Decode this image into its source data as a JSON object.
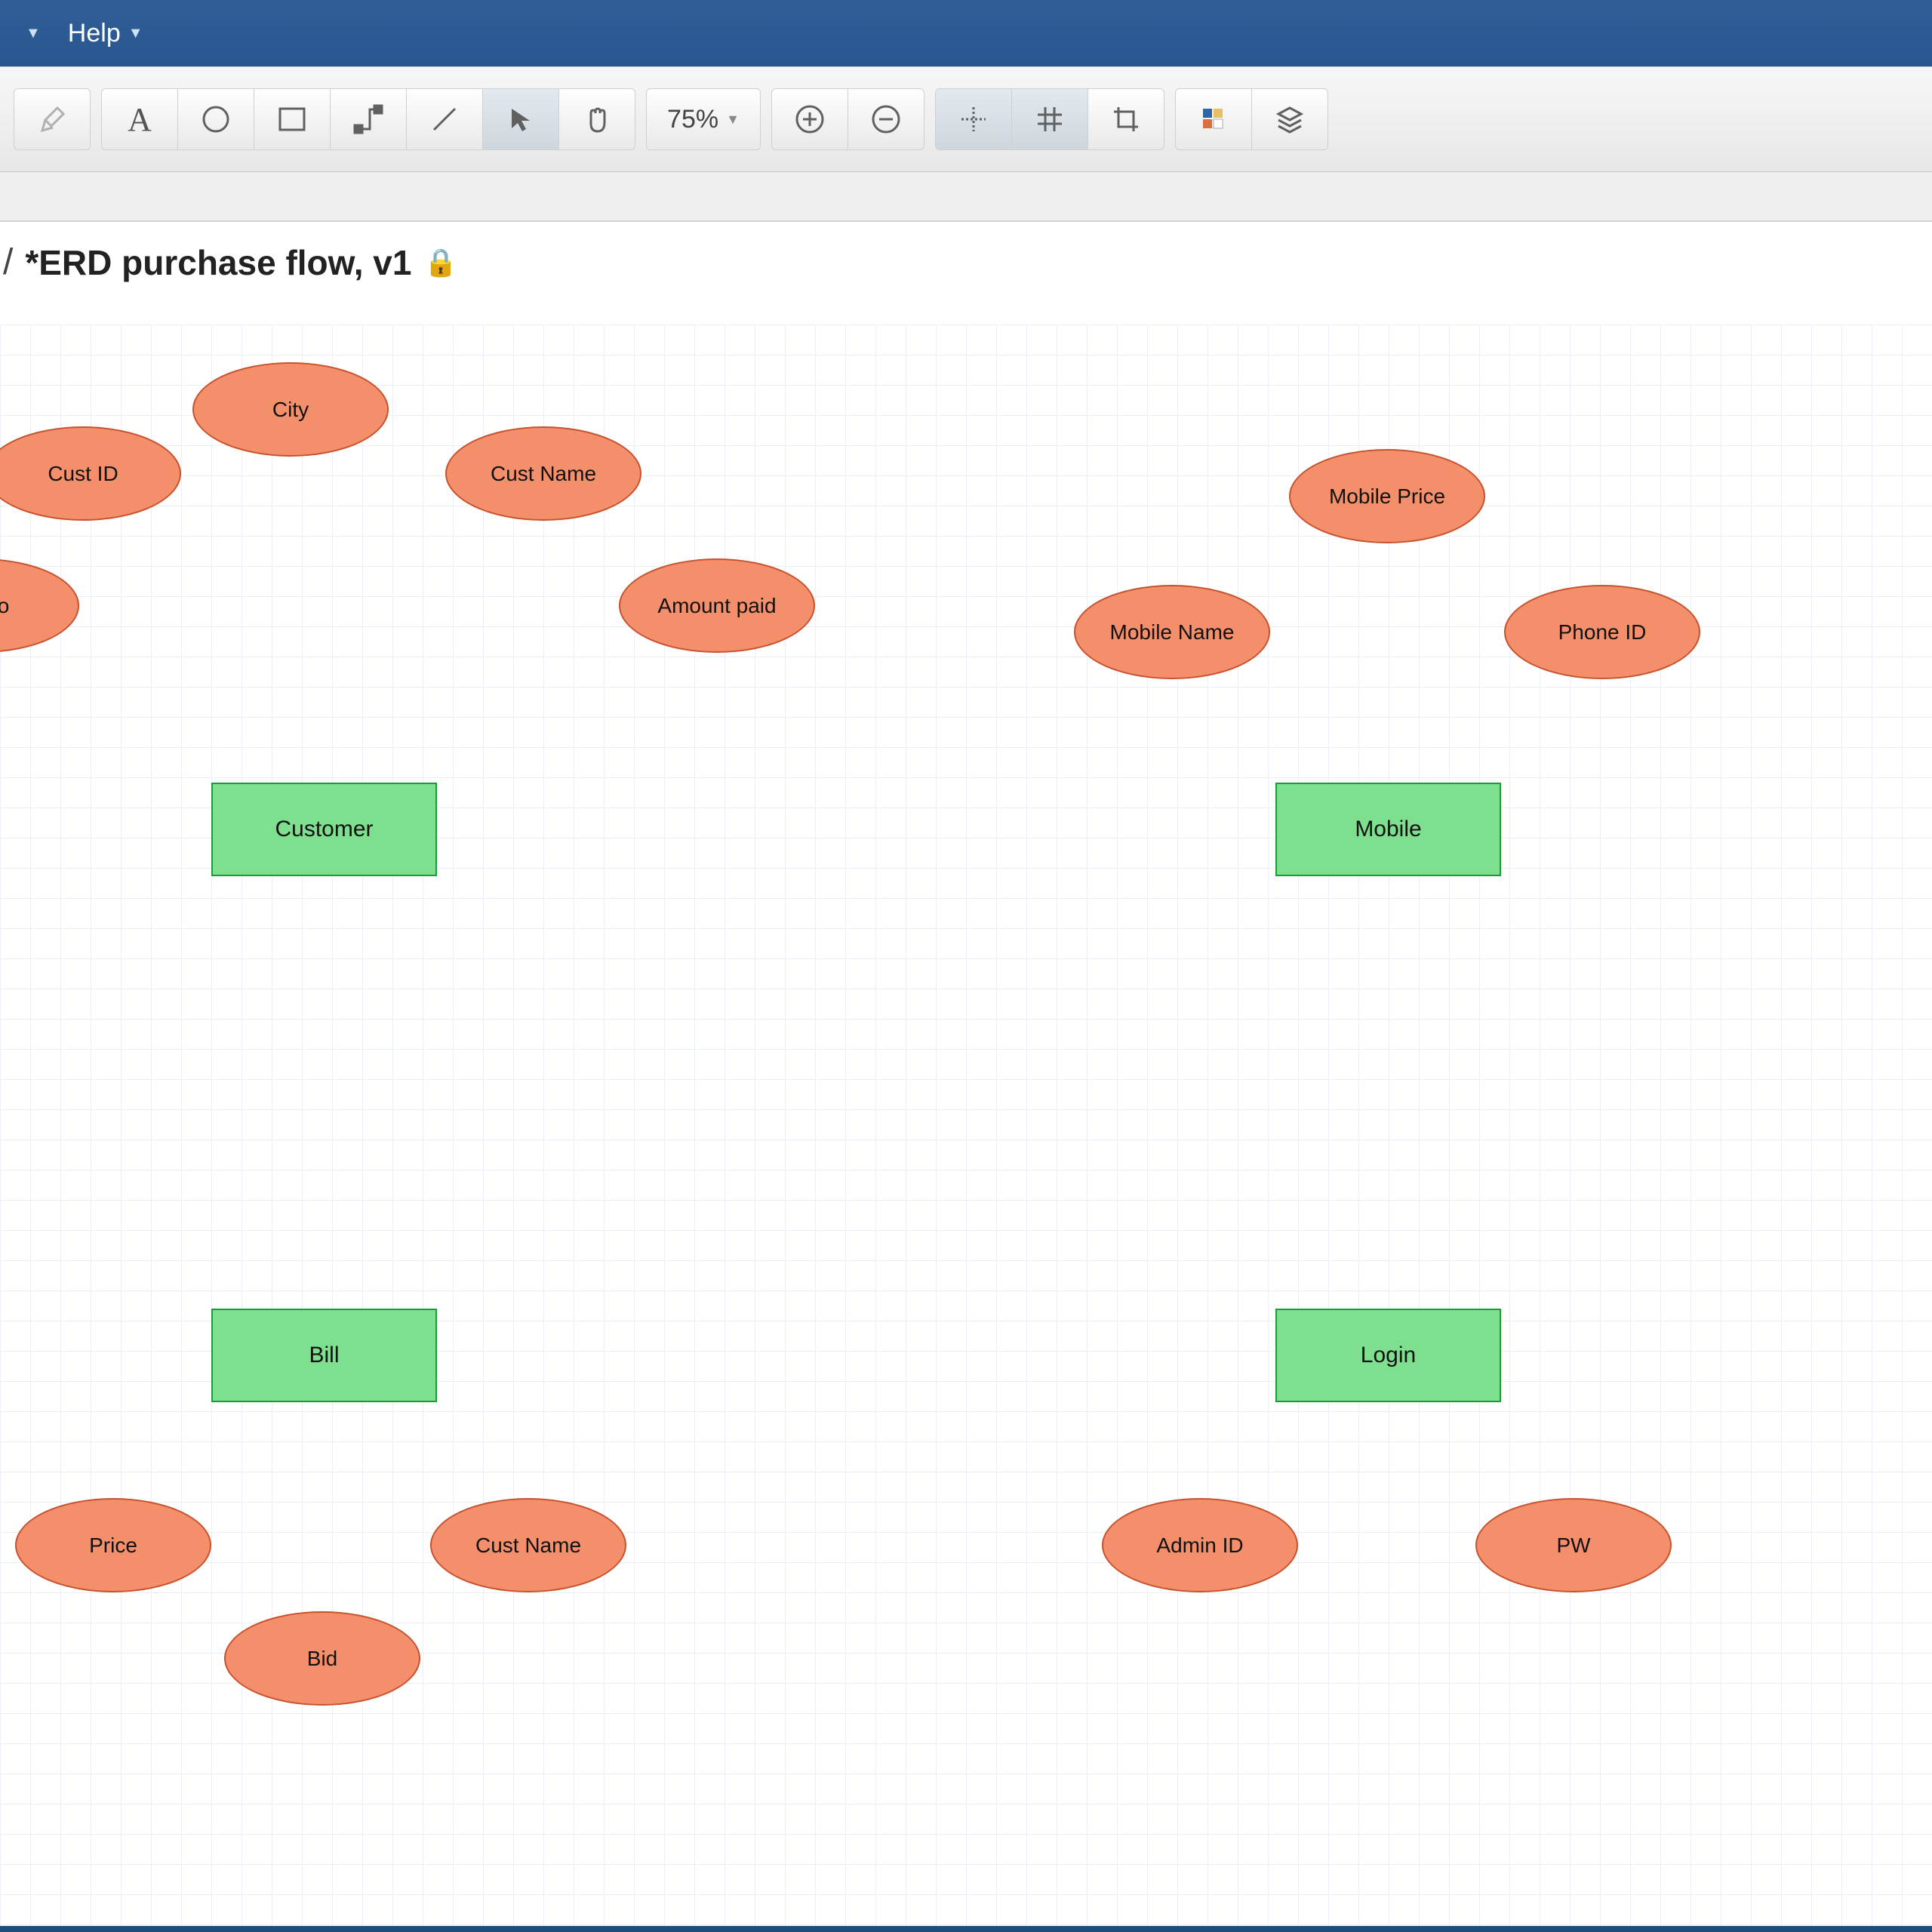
{
  "menubar": {
    "help_label": "Help"
  },
  "zoom": "75%",
  "title": {
    "prefix": "/",
    "doc": "*ERD purchase flow, v1"
  },
  "entities": {
    "customer": "Customer",
    "mobile": "Mobile",
    "bill": "Bill",
    "login": "Login"
  },
  "attributes": {
    "city": "City",
    "cust_id": "Cust ID",
    "cust_name": "Cust Name",
    "phone_no": "ne No",
    "amount_paid": "Amount paid",
    "mobile_price": "Mobile Price",
    "mobile_name": "Mobile Name",
    "phone_id": "Phone ID",
    "price": "Price",
    "bid": "Bid",
    "bill_cust_name": "Cust Name",
    "admin_id": "Admin ID",
    "pw": "PW"
  }
}
